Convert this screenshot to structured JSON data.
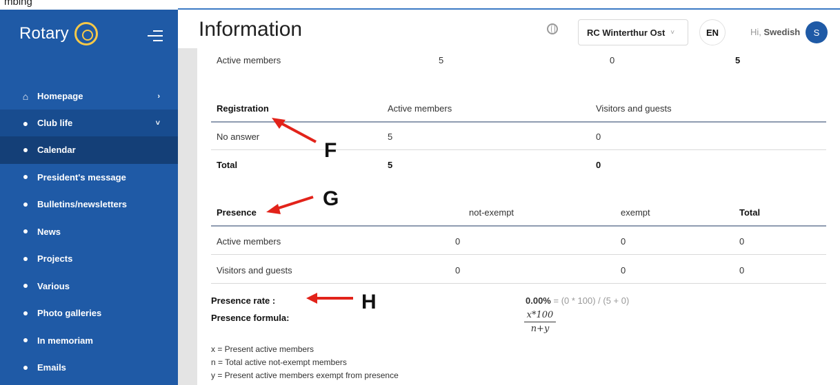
{
  "top_strip": {
    "text": "mbing"
  },
  "sidebar": {
    "brand": "Rotary",
    "items": [
      {
        "label": "Homepage",
        "icon": "home-icon"
      },
      {
        "label": "Club life",
        "icon": "globe-icon"
      }
    ],
    "subitems": [
      "Calendar",
      "President's message",
      "Bulletins/newsletters",
      "News",
      "Projects",
      "Various",
      "Photo galleries",
      "In memoriam",
      "Emails"
    ]
  },
  "header": {
    "title": "Information",
    "club": "RC Winterthur Ost",
    "lang": "EN",
    "greeting": "Hi,",
    "user": "Swedish",
    "avatar_letter": "S"
  },
  "summary_row": {
    "label": "Active members",
    "c1": "5",
    "c2": "0",
    "c3": "5"
  },
  "registration": {
    "headers": [
      "Registration",
      "Active members",
      "Visitors and guests"
    ],
    "rows": [
      [
        "No answer",
        "5",
        "0"
      ]
    ],
    "total": [
      "Total",
      "5",
      "0"
    ]
  },
  "presence": {
    "headers": [
      "Presence",
      "not-exempt",
      "exempt",
      "Total"
    ],
    "rows": [
      [
        "Active members",
        "0",
        "0",
        "0"
      ],
      [
        "Visitors and guests",
        "0",
        "0",
        "0"
      ]
    ]
  },
  "presence_rate": {
    "label": "Presence rate :",
    "value": "0.00%",
    "calc": " = (0 * 100) / (5 + 0)"
  },
  "presence_formula": {
    "label": "Presence formula:",
    "numerator": "x*100",
    "denominator": "n+y"
  },
  "legend": [
    "x = Present active members",
    "n = Total active not-exempt members",
    "y = Present active members exempt from presence"
  ],
  "annotations": {
    "f": "F",
    "g": "G",
    "h": "H"
  },
  "colors": {
    "sidebar": "#1f5aa6",
    "arrow": "#e2231a"
  }
}
